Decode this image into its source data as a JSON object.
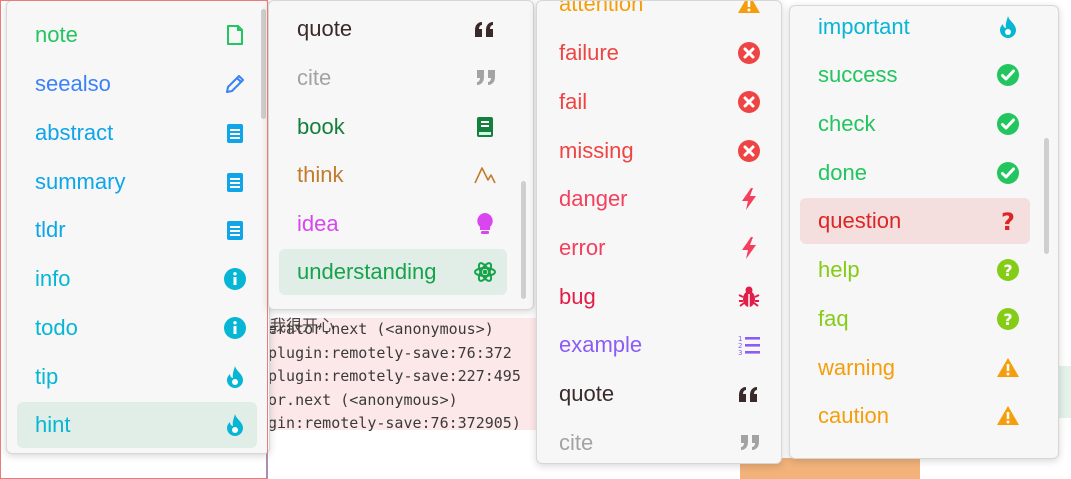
{
  "background": {
    "console_lines": [
      "erator.next (<anonymous>)",
      "plugin:remotely-save:76:372",
      "plugin:remotely-save:227:495",
      "or.next (<anonymous>)",
      "gin:remotely-save:76:372905)"
    ],
    "partial_chinese_text": "我很开心"
  },
  "menus": [
    {
      "items": [
        {
          "label": "note",
          "icon": "file-icon",
          "color": "#22c55e"
        },
        {
          "label": "seealso",
          "icon": "pencil-icon",
          "color": "#3b82f6"
        },
        {
          "label": "abstract",
          "icon": "clipboard-icon",
          "color": "#0ea5e9"
        },
        {
          "label": "summary",
          "icon": "clipboard-icon",
          "color": "#0ea5e9"
        },
        {
          "label": "tldr",
          "icon": "clipboard-icon",
          "color": "#0ea5e9"
        },
        {
          "label": "info",
          "icon": "info-icon",
          "color": "#06b6d4"
        },
        {
          "label": "todo",
          "icon": "info-icon",
          "color": "#06b6d4"
        },
        {
          "label": "tip",
          "icon": "flame-icon",
          "color": "#06b6d4"
        },
        {
          "label": "hint",
          "icon": "flame-icon",
          "color": "#06b6d4",
          "selected": true
        }
      ]
    },
    {
      "items": [
        {
          "label": "quote",
          "icon": "quote-open-icon",
          "color": "#3b2a2a"
        },
        {
          "label": "cite",
          "icon": "quote-close-icon",
          "color": "#a3a3a3"
        },
        {
          "label": "book",
          "icon": "book-icon",
          "color": "#15803d"
        },
        {
          "label": "think",
          "icon": "mountain-icon",
          "color": "#c27c2c"
        },
        {
          "label": "idea",
          "icon": "bulb-icon",
          "color": "#d946ef"
        },
        {
          "label": "understanding",
          "icon": "atom-icon",
          "color": "#16a34a",
          "selected": true
        }
      ]
    },
    {
      "items": [
        {
          "label": "attention",
          "icon": "warning-icon",
          "color": "#f59e0b"
        },
        {
          "label": "failure",
          "icon": "x-circle-icon",
          "color": "#ef4444"
        },
        {
          "label": "fail",
          "icon": "x-circle-icon",
          "color": "#ef4444"
        },
        {
          "label": "missing",
          "icon": "x-circle-icon",
          "color": "#ef4444"
        },
        {
          "label": "danger",
          "icon": "bolt-icon",
          "color": "#f43f5e"
        },
        {
          "label": "error",
          "icon": "bolt-icon",
          "color": "#f43f5e"
        },
        {
          "label": "bug",
          "icon": "bug-icon",
          "color": "#e11d48"
        },
        {
          "label": "example",
          "icon": "list-ordered-icon",
          "color": "#8b5cf6"
        },
        {
          "label": "quote",
          "icon": "quote-open-icon",
          "color": "#3b2a2a"
        },
        {
          "label": "cite",
          "icon": "quote-close-icon",
          "color": "#a3a3a3"
        }
      ]
    },
    {
      "items": [
        {
          "label": "important",
          "icon": "flame-icon",
          "color": "#06b6d4"
        },
        {
          "label": "success",
          "icon": "check-circle-icon",
          "color": "#22c55e"
        },
        {
          "label": "check",
          "icon": "check-circle-icon",
          "color": "#22c55e"
        },
        {
          "label": "done",
          "icon": "check-circle-icon",
          "color": "#22c55e"
        },
        {
          "label": "question",
          "icon": "question-icon",
          "color": "#dc2626",
          "selected": true
        },
        {
          "label": "help",
          "icon": "question-circle-icon",
          "color": "#84cc16"
        },
        {
          "label": "faq",
          "icon": "question-circle-icon",
          "color": "#84cc16"
        },
        {
          "label": "warning",
          "icon": "warning-icon",
          "color": "#f59e0b"
        },
        {
          "label": "caution",
          "icon": "warning-icon",
          "color": "#f59e0b"
        }
      ]
    }
  ]
}
